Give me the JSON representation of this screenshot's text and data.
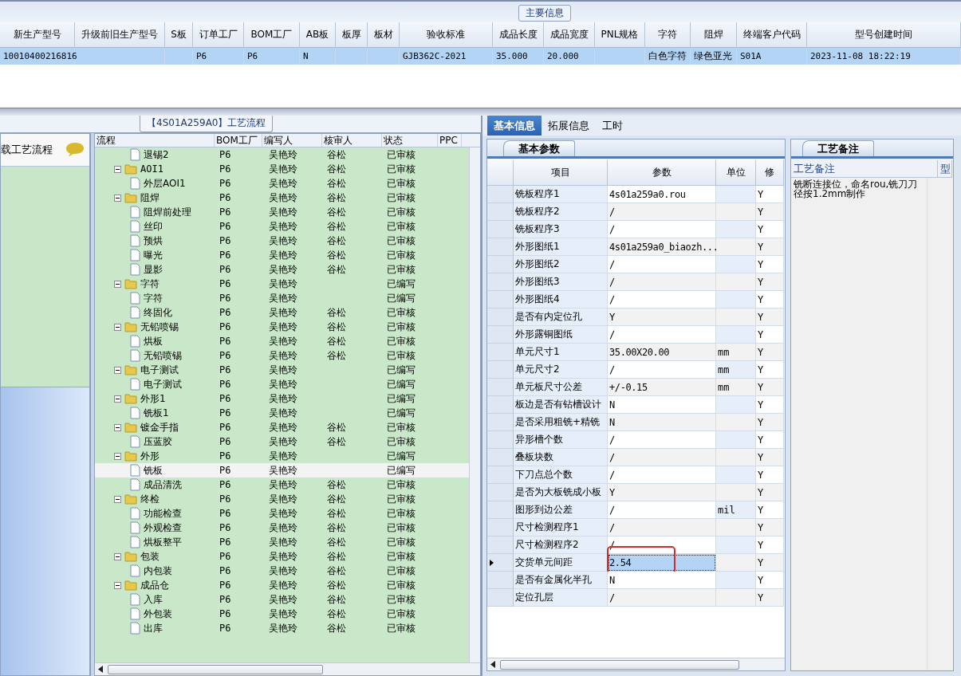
{
  "top_panel": {
    "title": "主要信息",
    "columns": [
      "新生产型号",
      "升级前旧生产型号",
      "S板",
      "订单工厂",
      "BOM工厂",
      "AB板",
      "板厚",
      "板材",
      "验收标准",
      "成品长度",
      "成品宽度",
      "PNL规格",
      "字符",
      "阻焊",
      "终端客户代码",
      "型号创建时间"
    ],
    "rows": [
      {
        "selected": true,
        "cells": [
          "10010400216816",
          "",
          "",
          "P6",
          "P6",
          "N",
          "",
          "",
          "GJB362C-2021",
          "35.000",
          "20.000",
          "",
          "白色字符",
          "绿色亚光",
          "S01A",
          "2023-11-08 18:22:19"
        ]
      }
    ]
  },
  "process_panel": {
    "title": "【4S01A259A0】工艺流程",
    "sidebar_label": "载工艺流程",
    "columns": [
      "流程",
      "BOM工厂",
      "编写人",
      "核审人",
      "状态",
      "PPC"
    ],
    "tree": [
      {
        "kind": "file",
        "name": "退锡2",
        "bom": "P6",
        "writer": "吴艳玲",
        "reviewer": "谷松",
        "status": "已审核",
        "selected": false
      },
      {
        "kind": "folder",
        "expanded": true,
        "name": "AOI1",
        "bom": "P6",
        "writer": "吴艳玲",
        "reviewer": "谷松",
        "status": "已审核",
        "selected": false,
        "children": [
          {
            "kind": "file",
            "name": "外层AOI1",
            "bom": "P6",
            "writer": "吴艳玲",
            "reviewer": "谷松",
            "status": "已审核",
            "selected": false
          }
        ]
      },
      {
        "kind": "folder",
        "expanded": true,
        "name": "阻焊",
        "bom": "P6",
        "writer": "吴艳玲",
        "reviewer": "谷松",
        "status": "已审核",
        "selected": false,
        "children": [
          {
            "kind": "file",
            "name": "阻焊前处理",
            "bom": "P6",
            "writer": "吴艳玲",
            "reviewer": "谷松",
            "status": "已审核",
            "selected": false
          },
          {
            "kind": "file",
            "name": "丝印",
            "bom": "P6",
            "writer": "吴艳玲",
            "reviewer": "谷松",
            "status": "已审核",
            "selected": false
          },
          {
            "kind": "file",
            "name": "预烘",
            "bom": "P6",
            "writer": "吴艳玲",
            "reviewer": "谷松",
            "status": "已审核",
            "selected": false
          },
          {
            "kind": "file",
            "name": "曝光",
            "bom": "P6",
            "writer": "吴艳玲",
            "reviewer": "谷松",
            "status": "已审核",
            "selected": false
          },
          {
            "kind": "file",
            "name": "显影",
            "bom": "P6",
            "writer": "吴艳玲",
            "reviewer": "谷松",
            "status": "已审核",
            "selected": false
          }
        ]
      },
      {
        "kind": "folder",
        "expanded": true,
        "name": "字符",
        "bom": "P6",
        "writer": "吴艳玲",
        "status": "已编写",
        "selected": false,
        "children": [
          {
            "kind": "file",
            "name": "字符",
            "bom": "P6",
            "writer": "吴艳玲",
            "status": "已编写",
            "selected": false
          },
          {
            "kind": "file",
            "name": "终固化",
            "bom": "P6",
            "writer": "吴艳玲",
            "reviewer": "谷松",
            "status": "已审核",
            "selected": false
          }
        ]
      },
      {
        "kind": "folder",
        "expanded": true,
        "name": "无铅喷锡",
        "bom": "P6",
        "writer": "吴艳玲",
        "reviewer": "谷松",
        "status": "已审核",
        "selected": false,
        "children": [
          {
            "kind": "file",
            "name": "烘板",
            "bom": "P6",
            "writer": "吴艳玲",
            "reviewer": "谷松",
            "status": "已审核",
            "selected": false
          },
          {
            "kind": "file",
            "name": "无铅喷锡",
            "bom": "P6",
            "writer": "吴艳玲",
            "reviewer": "谷松",
            "status": "已审核",
            "selected": false
          }
        ]
      },
      {
        "kind": "folder",
        "expanded": true,
        "name": "电子测试",
        "bom": "P6",
        "writer": "吴艳玲",
        "status": "已编写",
        "selected": false,
        "children": [
          {
            "kind": "file",
            "name": "电子测试",
            "bom": "P6",
            "writer": "吴艳玲",
            "status": "已编写",
            "selected": false
          }
        ]
      },
      {
        "kind": "folder",
        "expanded": true,
        "name": "外形1",
        "bom": "P6",
        "writer": "吴艳玲",
        "status": "已编写",
        "selected": false,
        "children": [
          {
            "kind": "file",
            "name": "铣板1",
            "bom": "P6",
            "writer": "吴艳玲",
            "status": "已编写",
            "selected": false
          }
        ]
      },
      {
        "kind": "folder",
        "expanded": true,
        "name": "镀金手指",
        "bom": "P6",
        "writer": "吴艳玲",
        "reviewer": "谷松",
        "status": "已审核",
        "selected": false,
        "children": [
          {
            "kind": "file",
            "name": "压蓝胶",
            "bom": "P6",
            "writer": "吴艳玲",
            "reviewer": "谷松",
            "status": "已审核",
            "selected": false
          }
        ]
      },
      {
        "kind": "folder",
        "expanded": true,
        "name": "外形",
        "bom": "P6",
        "writer": "吴艳玲",
        "status": "已编写",
        "selected": false,
        "children": [
          {
            "kind": "file",
            "name": "铣板",
            "bom": "P6",
            "writer": "吴艳玲",
            "status": "已编写",
            "selected": true
          },
          {
            "kind": "file",
            "name": "成品清洗",
            "bom": "P6",
            "writer": "吴艳玲",
            "reviewer": "谷松",
            "status": "已审核",
            "selected": false
          }
        ]
      },
      {
        "kind": "folder",
        "expanded": true,
        "name": "终检",
        "bom": "P6",
        "writer": "吴艳玲",
        "reviewer": "谷松",
        "status": "已审核",
        "selected": false,
        "children": [
          {
            "kind": "file",
            "name": "功能检查",
            "bom": "P6",
            "writer": "吴艳玲",
            "reviewer": "谷松",
            "status": "已审核",
            "selected": false
          },
          {
            "kind": "file",
            "name": "外观检查",
            "bom": "P6",
            "writer": "吴艳玲",
            "reviewer": "谷松",
            "status": "已审核",
            "selected": false
          },
          {
            "kind": "file",
            "name": "烘板整平",
            "bom": "P6",
            "writer": "吴艳玲",
            "reviewer": "谷松",
            "status": "已审核",
            "selected": false
          }
        ]
      },
      {
        "kind": "folder",
        "expanded": true,
        "name": "包装",
        "bom": "P6",
        "writer": "吴艳玲",
        "reviewer": "谷松",
        "status": "已审核",
        "selected": false,
        "children": [
          {
            "kind": "file",
            "name": "内包装",
            "bom": "P6",
            "writer": "吴艳玲",
            "reviewer": "谷松",
            "status": "已审核",
            "selected": false
          }
        ]
      },
      {
        "kind": "folder",
        "expanded": true,
        "name": "成品仓",
        "bom": "P6",
        "writer": "吴艳玲",
        "reviewer": "谷松",
        "status": "已审核",
        "selected": false,
        "children": [
          {
            "kind": "file",
            "name": "入库",
            "bom": "P6",
            "writer": "吴艳玲",
            "reviewer": "谷松",
            "status": "已审核",
            "selected": false
          },
          {
            "kind": "file",
            "name": "外包装",
            "bom": "P6",
            "writer": "吴艳玲",
            "reviewer": "谷松",
            "status": "已审核",
            "selected": false
          },
          {
            "kind": "file",
            "name": "出库",
            "bom": "P6",
            "writer": "吴艳玲",
            "reviewer": "谷松",
            "status": "已审核",
            "selected": false
          }
        ]
      }
    ]
  },
  "detail_panel": {
    "tabs": [
      {
        "label": "基本信息",
        "selected": true
      },
      {
        "label": "拓展信息",
        "selected": false
      },
      {
        "label": "工时",
        "selected": false
      }
    ],
    "subtab": "基本参数",
    "columns": [
      "项目",
      "参数",
      "单位",
      "修"
    ],
    "rows": [
      {
        "item": "铣板程序1",
        "param": "4s01a259a0.rou",
        "modified": "Y",
        "selected": false
      },
      {
        "item": "铣板程序2",
        "param": "/",
        "modified": "Y",
        "selected": false
      },
      {
        "item": "铣板程序3",
        "param": "/",
        "modified": "Y",
        "selected": false
      },
      {
        "item": "外形图纸1",
        "param": "4s01a259a0_biaozh...",
        "modified": "Y",
        "selected": false
      },
      {
        "item": "外形图纸2",
        "param": "/",
        "modified": "Y",
        "selected": false
      },
      {
        "item": "外形图纸3",
        "param": "/",
        "modified": "Y",
        "selected": false
      },
      {
        "item": "外形图纸4",
        "param": "/",
        "modified": "Y",
        "selected": false
      },
      {
        "item": "是否有内定位孔",
        "param": "Y",
        "modified": "Y",
        "selected": false
      },
      {
        "item": "外形露铜图纸",
        "param": "/",
        "modified": "Y",
        "selected": false
      },
      {
        "item": "单元尺寸1",
        "param": "35.00X20.00",
        "unit": "mm",
        "modified": "Y",
        "selected": false
      },
      {
        "item": "单元尺寸2",
        "param": "/",
        "unit": "mm",
        "modified": "Y",
        "selected": false
      },
      {
        "item": "单元板尺寸公差",
        "param": "+/-0.15",
        "unit": "mm",
        "modified": "Y",
        "selected": false
      },
      {
        "item": "板边是否有钻槽设计",
        "param": "N",
        "modified": "Y",
        "selected": false
      },
      {
        "item": "是否采用粗铣+精铣",
        "param": "N",
        "modified": "Y",
        "selected": false
      },
      {
        "item": "异形槽个数",
        "param": "/",
        "modified": "Y",
        "selected": false
      },
      {
        "item": "叠板块数",
        "param": "/",
        "modified": "Y",
        "selected": false
      },
      {
        "item": "下刀点总个数",
        "param": "/",
        "modified": "Y",
        "selected": false
      },
      {
        "item": "是否为大板铣成小板",
        "param": "Y",
        "modified": "Y",
        "selected": false
      },
      {
        "item": "图形到边公差",
        "param": "/",
        "unit": "mil",
        "modified": "Y",
        "selected": false
      },
      {
        "item": "尺寸检测程序1",
        "param": "/",
        "modified": "Y",
        "selected": false
      },
      {
        "item": "尺寸检测程序2",
        "param": "/",
        "modified": "Y",
        "selected": false
      },
      {
        "item": "交货单元间距",
        "param": "2.54",
        "modified": "Y",
        "selected": true,
        "annotated": true
      },
      {
        "item": "是否有金属化半孔",
        "param": "N",
        "modified": "Y",
        "selected": false
      },
      {
        "item": "定位孔层",
        "param": "/",
        "modified": "Y",
        "selected": false
      }
    ]
  },
  "notes_panel": {
    "tab": "工艺备注",
    "columns": [
      "工艺备注",
      "型"
    ],
    "text": "铣断连接位，命名rou,铣刀刀径按1.2mm制作"
  }
}
